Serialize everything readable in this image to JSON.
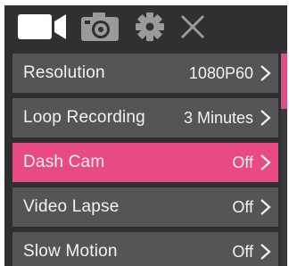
{
  "colors": {
    "background": "#2f2f31",
    "row": "#555558",
    "accent": "#e84a86",
    "text": "#f2f2f2",
    "inactive_icon": "#9a9a9c"
  },
  "topbar": {
    "tabs": [
      {
        "icon": "video-camera-icon",
        "active": true
      },
      {
        "icon": "photo-camera-icon",
        "active": false
      },
      {
        "icon": "gear-icon",
        "active": false
      },
      {
        "icon": "close-icon",
        "active": false
      }
    ]
  },
  "menu": {
    "items": [
      {
        "label": "Resolution",
        "value": "1080P60",
        "selected": false
      },
      {
        "label": "Loop Recording",
        "value": "3 Minutes",
        "selected": false
      },
      {
        "label": "Dash Cam",
        "value": "Off",
        "selected": true
      },
      {
        "label": "Video Lapse",
        "value": "Off",
        "selected": false
      },
      {
        "label": "Slow Motion",
        "value": "Off",
        "selected": false
      }
    ]
  },
  "scrollbar": {
    "position": 0
  }
}
